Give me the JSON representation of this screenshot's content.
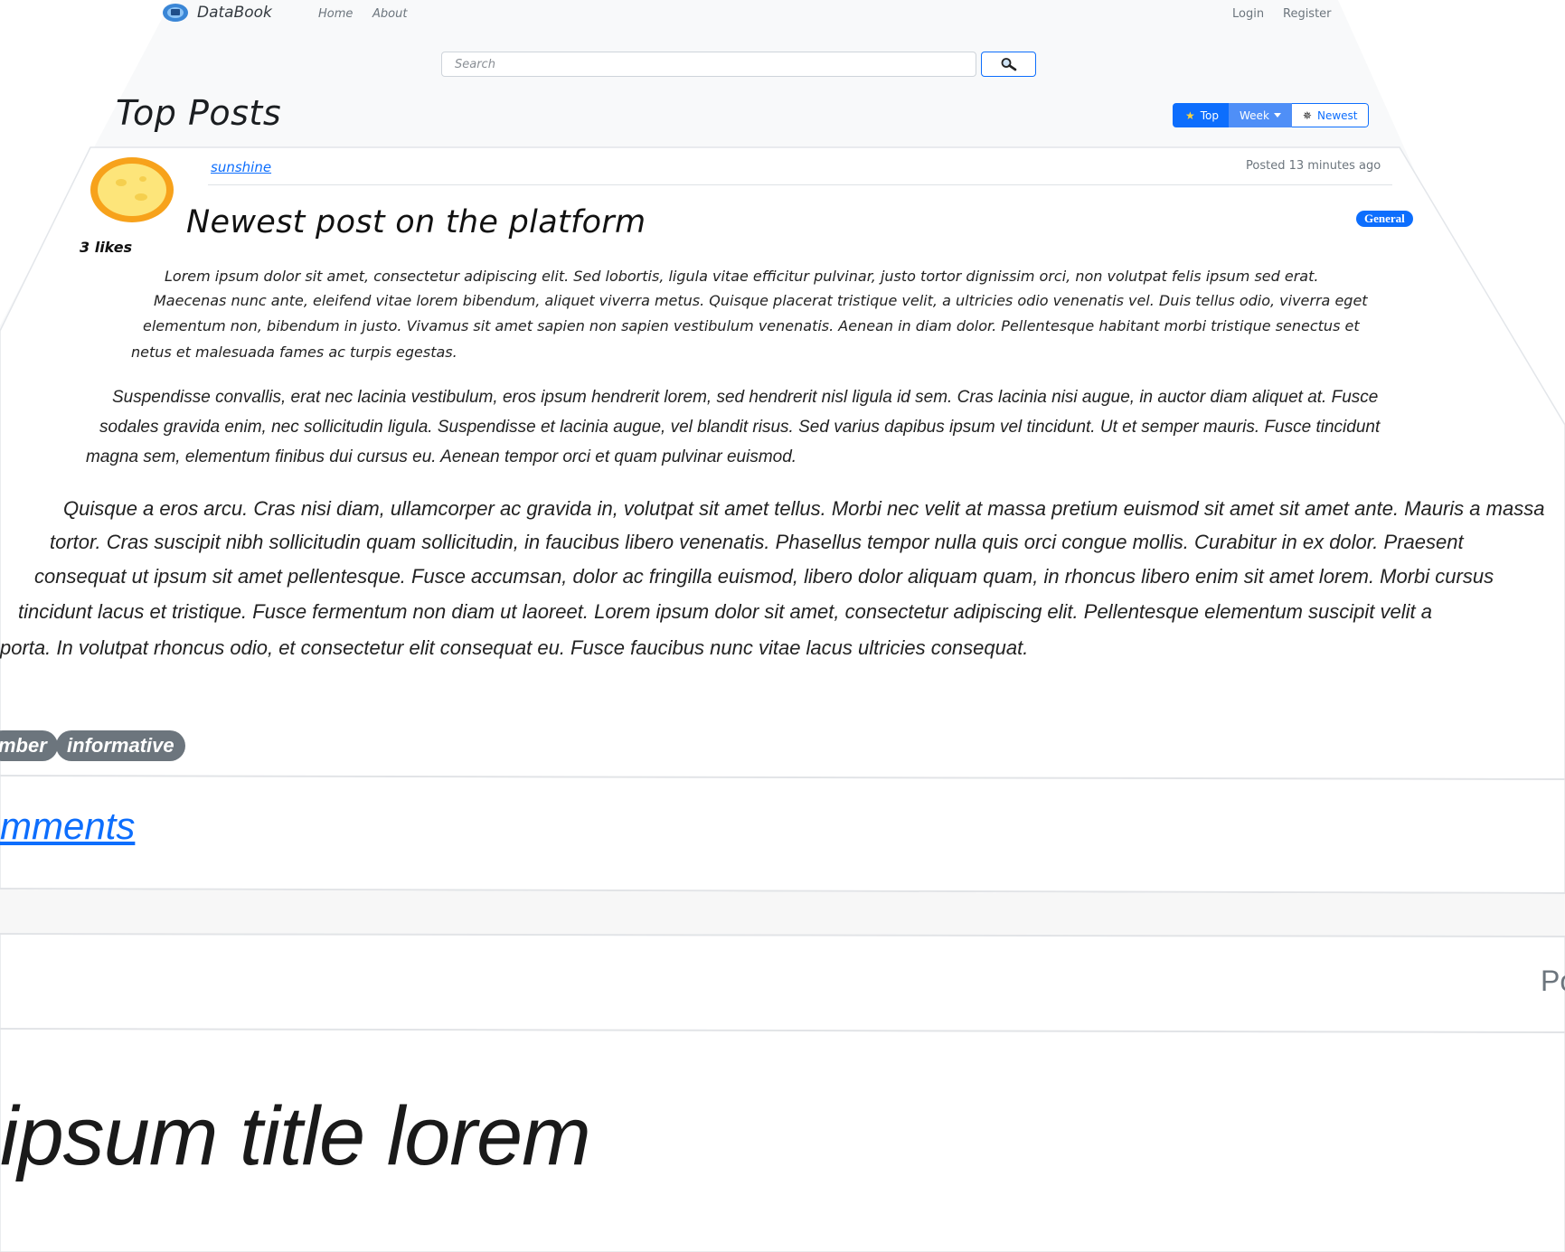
{
  "navbar": {
    "brand": "DataBook",
    "links": [
      "Home",
      "About"
    ],
    "auth": [
      "Login",
      "Register"
    ]
  },
  "search": {
    "placeholder": "Search"
  },
  "page": {
    "title": "Top Posts"
  },
  "sort": {
    "top": "Top",
    "week": "Week",
    "newest": "Newest"
  },
  "post": {
    "author": "sunshine",
    "posted": "Posted 13 minutes ago",
    "title": "Newest post on the platform",
    "category": "General",
    "likes": "3 likes",
    "paragraph1": [
      "Lorem ipsum dolor sit amet, consectetur adipiscing elit. Sed lobortis, ligula vitae efficitur pulvinar, justo tortor dignissim orci, non volutpat felis ipsum sed erat.",
      "Maecenas nunc ante, eleifend vitae lorem bibendum, aliquet viverra metus. Quisque placerat tristique velit, a ultricies odio venenatis vel. Duis tellus odio, viverra eget",
      "elementum non, bibendum in justo. Vivamus sit amet sapien non sapien vestibulum venenatis. Aenean in diam dolor. Pellentesque habitant morbi tristique senectus et",
      "netus et malesuada fames ac turpis egestas."
    ],
    "paragraph2": [
      "Suspendisse convallis, erat nec lacinia vestibulum, eros ipsum hendrerit lorem, sed hendrerit nisl ligula id sem. Cras lacinia nisi augue, in auctor diam aliquet at. Fusce",
      "sodales gravida enim, nec sollicitudin ligula. Suspendisse et lacinia augue, vel blandit risus. Sed varius dapibus ipsum vel tincidunt. Ut et semper mauris. Fusce tincidunt",
      "magna sem, elementum finibus dui cursus eu. Aenean tempor orci et quam pulvinar euismod."
    ],
    "paragraph3": [
      "Quisque a eros arcu. Cras nisi diam, ullamcorper ac gravida in, volutpat sit amet tellus. Morbi nec velit at massa pretium euismod sit amet sit amet ante. Mauris a massa",
      "tortor. Cras suscipit nibh sollicitudin quam sollicitudin, in faucibus libero venenatis. Phasellus tempor nulla quis orci congue mollis. Curabitur in ex dolor. Praesent",
      "consequat ut ipsum sit amet pellentesque. Fusce accumsan, dolor ac fringilla euismod, libero dolor aliquam quam, in rhoncus libero enim sit amet lorem. Morbi cursus",
      "tincidunt lacus et tristique. Fusce fermentum non diam ut laoreet. Lorem ipsum dolor sit amet, consectetur adipiscing elit. Pellentesque elementum suscipit velit a",
      "porta. In volutpat rhoncus odio, et consectetur elit consequat eu. Fusce faucibus nunc vitae lacus ultricies consequat."
    ],
    "tags": [
      "mber",
      "informative"
    ],
    "comments_link": "mments"
  },
  "next_post": {
    "posted_partial": "Po",
    "title_partial": "ipsum title lorem"
  },
  "colors": {
    "primary": "#0d6efd",
    "tag": "#6c757d",
    "sheet": "#f8f9fa"
  }
}
